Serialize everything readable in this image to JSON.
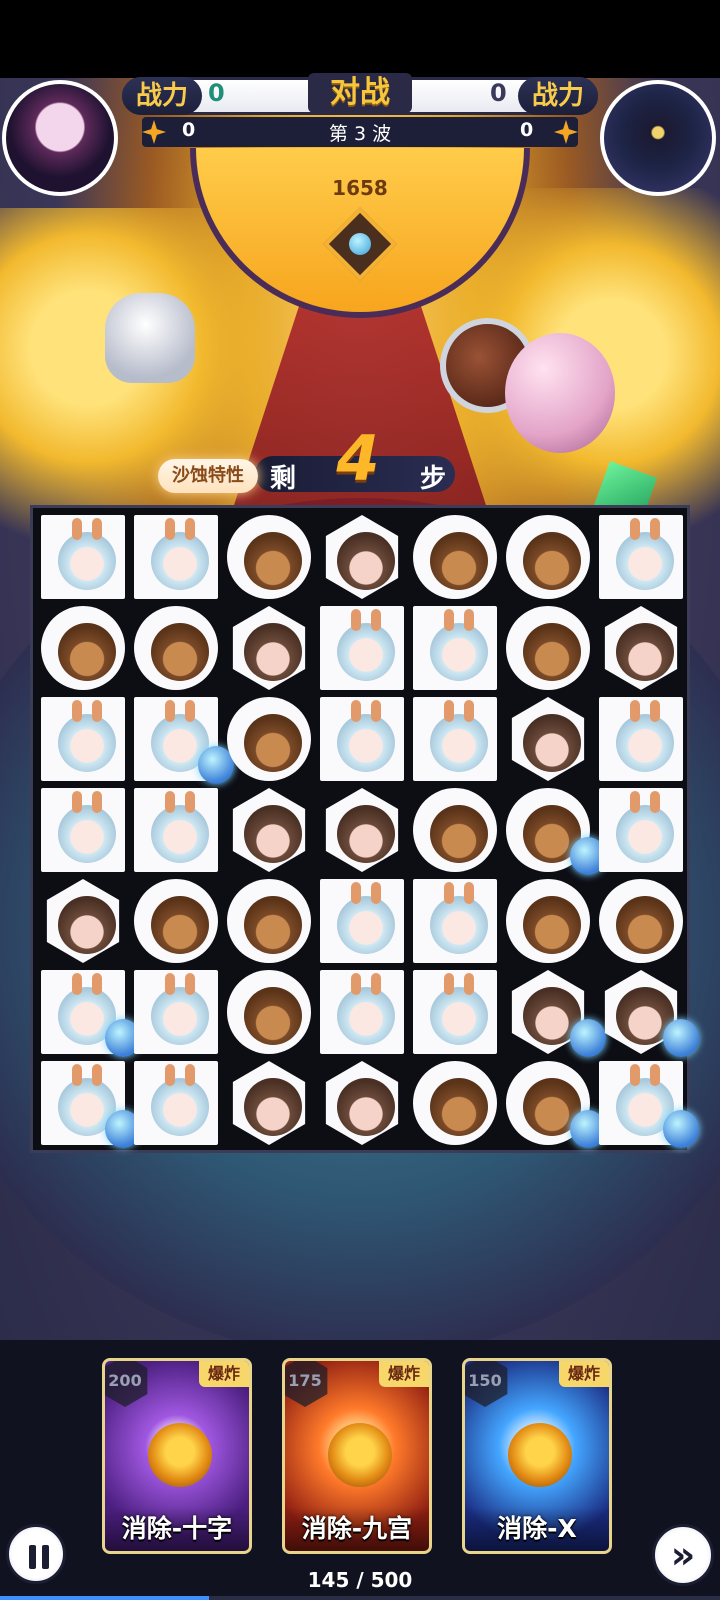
{
  "hud": {
    "power_label_left": "战力",
    "power_value_left": "0",
    "title": "对战",
    "power_value_right": "0",
    "power_label_right": "战力",
    "stars_left": "0",
    "wave": "第 3 波",
    "stars_right": "0"
  },
  "boss": {
    "hp": "1658"
  },
  "steps": {
    "trait_label": "沙蚀特性",
    "remain_label": "剩",
    "count": "4",
    "unit": "步"
  },
  "board": {
    "rows": [
      [
        [
          "bunny",
          "sq",
          false
        ],
        [
          "bunny",
          "sq",
          false
        ],
        [
          "monkey",
          "circ",
          false
        ],
        [
          "cat",
          "hex",
          false
        ],
        [
          "monkey",
          "circ",
          false
        ],
        [
          "monkey",
          "circ",
          false
        ],
        [
          "bunny",
          "sq",
          false
        ]
      ],
      [
        [
          "monkey",
          "circ",
          false
        ],
        [
          "monkey",
          "circ",
          false
        ],
        [
          "cat",
          "hex",
          false
        ],
        [
          "bunny",
          "sq",
          false
        ],
        [
          "bunny",
          "sq",
          false
        ],
        [
          "monkey",
          "circ",
          false
        ],
        [
          "cat",
          "hex",
          false
        ]
      ],
      [
        [
          "bunny",
          "sq",
          false
        ],
        [
          "bunny",
          "sq",
          true
        ],
        [
          "monkey",
          "circ",
          false
        ],
        [
          "bunny",
          "sq",
          false
        ],
        [
          "bunny",
          "sq",
          false
        ],
        [
          "cat",
          "hex",
          false
        ],
        [
          "bunny",
          "sq",
          false
        ]
      ],
      [
        [
          "bunny",
          "sq",
          false
        ],
        [
          "bunny",
          "sq",
          false
        ],
        [
          "cat",
          "hex",
          false
        ],
        [
          "cat",
          "hex",
          false
        ],
        [
          "monkey",
          "circ",
          false
        ],
        [
          "monkey",
          "circ",
          true
        ],
        [
          "bunny",
          "sq",
          false
        ]
      ],
      [
        [
          "cat",
          "hex",
          false
        ],
        [
          "monkey",
          "circ",
          false
        ],
        [
          "monkey",
          "circ",
          false
        ],
        [
          "bunny",
          "sq",
          false
        ],
        [
          "bunny",
          "sq",
          false
        ],
        [
          "monkey",
          "circ",
          false
        ],
        [
          "monkey",
          "circ",
          false
        ]
      ],
      [
        [
          "bunny",
          "sq",
          true
        ],
        [
          "bunny",
          "sq",
          false
        ],
        [
          "monkey",
          "circ",
          false
        ],
        [
          "bunny",
          "sq",
          false
        ],
        [
          "bunny",
          "sq",
          false
        ],
        [
          "cat",
          "hex",
          true
        ],
        [
          "cat",
          "hex",
          true
        ]
      ],
      [
        [
          "bunny",
          "sq",
          true
        ],
        [
          "bunny",
          "sq",
          false
        ],
        [
          "cat",
          "hex",
          false
        ],
        [
          "cat",
          "hex",
          false
        ],
        [
          "monkey",
          "circ",
          false
        ],
        [
          "monkey",
          "circ",
          true
        ],
        [
          "bunny",
          "sq",
          true
        ]
      ]
    ]
  },
  "skills": [
    {
      "cost": "200",
      "tag": "爆炸",
      "name": "消除-十字",
      "theme": "purple"
    },
    {
      "cost": "175",
      "tag": "爆炸",
      "name": "消除-九宫",
      "theme": "fire"
    },
    {
      "cost": "150",
      "tag": "爆炸",
      "name": "消除-X",
      "theme": "blue"
    }
  ],
  "controls": {
    "next_icon": "»",
    "pause_icon": "pause-icon"
  },
  "progress": {
    "text": "145 / 500",
    "fraction": 0.29
  },
  "colors": {
    "accent_gold": "#f8c63a",
    "power_green": "#1f8f7a",
    "progress_blue": "#3f8fff"
  }
}
